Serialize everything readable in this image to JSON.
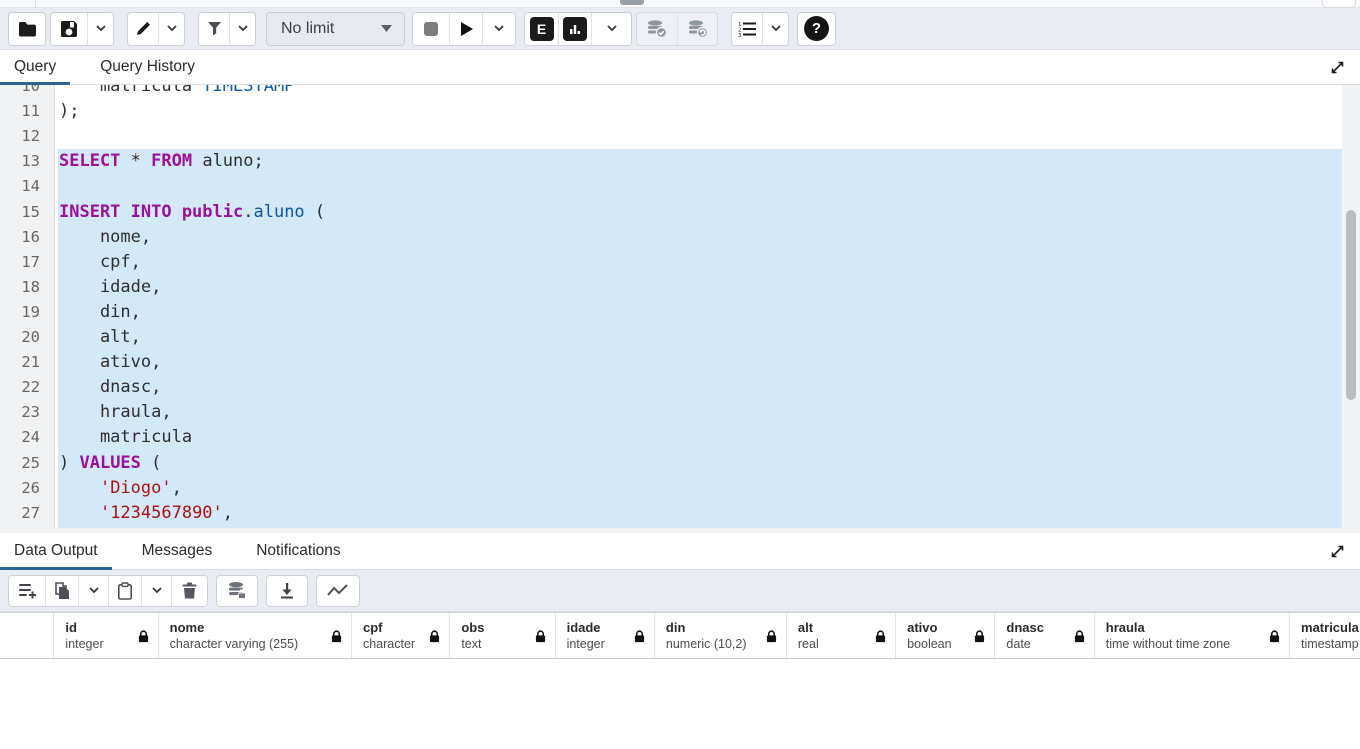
{
  "colors": {
    "accent": "#2c6690",
    "selection": "#d3e9f8",
    "keyword": "#9b0f9b",
    "type": "#0a57a5",
    "string": "#aa1111",
    "toolbar_bg": "#e9ecf3"
  },
  "toolbar": {
    "limit_value": "No limit",
    "explain_label": "E",
    "help_label": "?"
  },
  "query_tabs": {
    "tabs": [
      {
        "label": "Query",
        "active": true
      },
      {
        "label": "Query History",
        "active": false
      }
    ]
  },
  "editor": {
    "first_line_number": 10,
    "selection_start_line": 13,
    "lines": [
      {
        "n": "10",
        "seg": [
          {
            "c": "plain",
            "t": "    matricula "
          },
          {
            "c": "type",
            "t": "TIMESTAMP"
          }
        ]
      },
      {
        "n": "11",
        "seg": [
          {
            "c": "plain",
            "t": ");"
          }
        ]
      },
      {
        "n": "12",
        "seg": []
      },
      {
        "n": "13",
        "seg": [
          {
            "c": "kw",
            "t": "SELECT"
          },
          {
            "c": "plain",
            "t": " * "
          },
          {
            "c": "kw",
            "t": "FROM"
          },
          {
            "c": "plain",
            "t": " aluno;"
          }
        ]
      },
      {
        "n": "14",
        "seg": []
      },
      {
        "n": "15",
        "seg": [
          {
            "c": "kw",
            "t": "INSERT INTO public"
          },
          {
            "c": "plain",
            "t": "."
          },
          {
            "c": "type",
            "t": "aluno"
          },
          {
            "c": "plain",
            "t": " ("
          }
        ]
      },
      {
        "n": "16",
        "seg": [
          {
            "c": "plain",
            "t": "    nome,"
          }
        ]
      },
      {
        "n": "17",
        "seg": [
          {
            "c": "plain",
            "t": "    cpf,"
          }
        ]
      },
      {
        "n": "18",
        "seg": [
          {
            "c": "plain",
            "t": "    idade,"
          }
        ]
      },
      {
        "n": "19",
        "seg": [
          {
            "c": "plain",
            "t": "    din,"
          }
        ]
      },
      {
        "n": "20",
        "seg": [
          {
            "c": "plain",
            "t": "    alt,"
          }
        ]
      },
      {
        "n": "21",
        "seg": [
          {
            "c": "plain",
            "t": "    ativo,"
          }
        ]
      },
      {
        "n": "22",
        "seg": [
          {
            "c": "plain",
            "t": "    dnasc,"
          }
        ]
      },
      {
        "n": "23",
        "seg": [
          {
            "c": "plain",
            "t": "    hraula,"
          }
        ]
      },
      {
        "n": "24",
        "seg": [
          {
            "c": "plain",
            "t": "    matricula"
          }
        ]
      },
      {
        "n": "25",
        "seg": [
          {
            "c": "plain",
            "t": ") "
          },
          {
            "c": "kw",
            "t": "VALUES"
          },
          {
            "c": "plain",
            "t": " ("
          }
        ]
      },
      {
        "n": "26",
        "seg": [
          {
            "c": "plain",
            "t": "    "
          },
          {
            "c": "str",
            "t": "'Diogo'"
          },
          {
            "c": "plain",
            "t": ","
          }
        ]
      },
      {
        "n": "27",
        "seg": [
          {
            "c": "plain",
            "t": "    "
          },
          {
            "c": "str",
            "t": "'1234567890'"
          },
          {
            "c": "plain",
            "t": ","
          }
        ]
      }
    ]
  },
  "output_tabs": {
    "tabs": [
      {
        "label": "Data Output",
        "active": true
      },
      {
        "label": "Messages",
        "active": false
      },
      {
        "label": "Notifications",
        "active": false
      }
    ]
  },
  "grid": {
    "columns": [
      {
        "name": "id",
        "type": "integer",
        "width": 105
      },
      {
        "name": "nome",
        "type": "character varying (255)",
        "width": 195
      },
      {
        "name": "cpf",
        "type": "character",
        "width": 99
      },
      {
        "name": "obs",
        "type": "text",
        "width": 106
      },
      {
        "name": "idade",
        "type": "integer",
        "width": 100
      },
      {
        "name": "din",
        "type": "numeric (10,2)",
        "width": 133
      },
      {
        "name": "alt",
        "type": "real",
        "width": 110
      },
      {
        "name": "ativo",
        "type": "boolean",
        "width": 100
      },
      {
        "name": "dnasc",
        "type": "date",
        "width": 100
      },
      {
        "name": "hraula",
        "type": "time without time zone",
        "width": 197
      },
      {
        "name": "matricula",
        "type": "timestamp without time zone",
        "width": 190
      }
    ]
  }
}
